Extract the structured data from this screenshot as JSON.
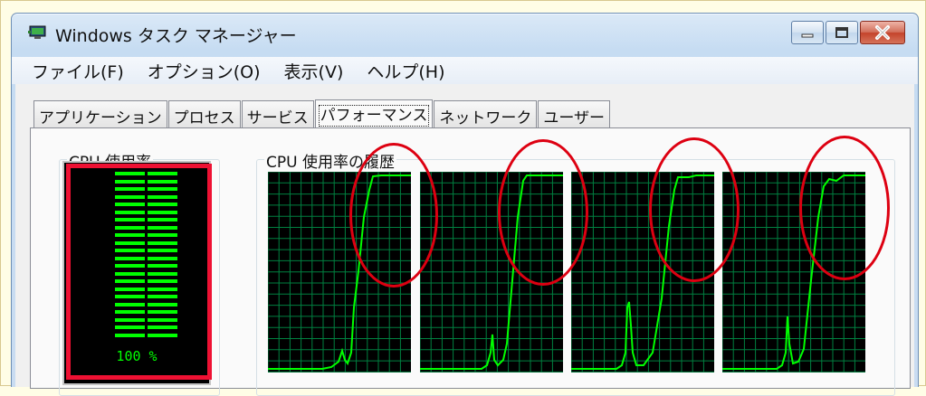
{
  "window": {
    "title": "Windows タスク マネージャー",
    "icon": "monitor-icon"
  },
  "menu": [
    {
      "label": "ファイル(F)"
    },
    {
      "label": "オプション(O)"
    },
    {
      "label": "表示(V)"
    },
    {
      "label": "ヘルプ(H)"
    }
  ],
  "tabs": [
    {
      "label": "アプリケーション",
      "active": false
    },
    {
      "label": "プロセス",
      "active": false
    },
    {
      "label": "サービス",
      "active": false
    },
    {
      "label": "パフォーマンス",
      "active": true
    },
    {
      "label": "ネットワーク",
      "active": false
    },
    {
      "label": "ユーザー",
      "active": false
    }
  ],
  "cpu_usage": {
    "label": "CPU 使用率",
    "value_text": "100 %",
    "percent": 100
  },
  "cpu_history": {
    "label": "CPU 使用率の履歴"
  },
  "colors": {
    "graph_line": "#00ff00",
    "graph_grid": "#008040",
    "annotation": "#e01020"
  }
}
